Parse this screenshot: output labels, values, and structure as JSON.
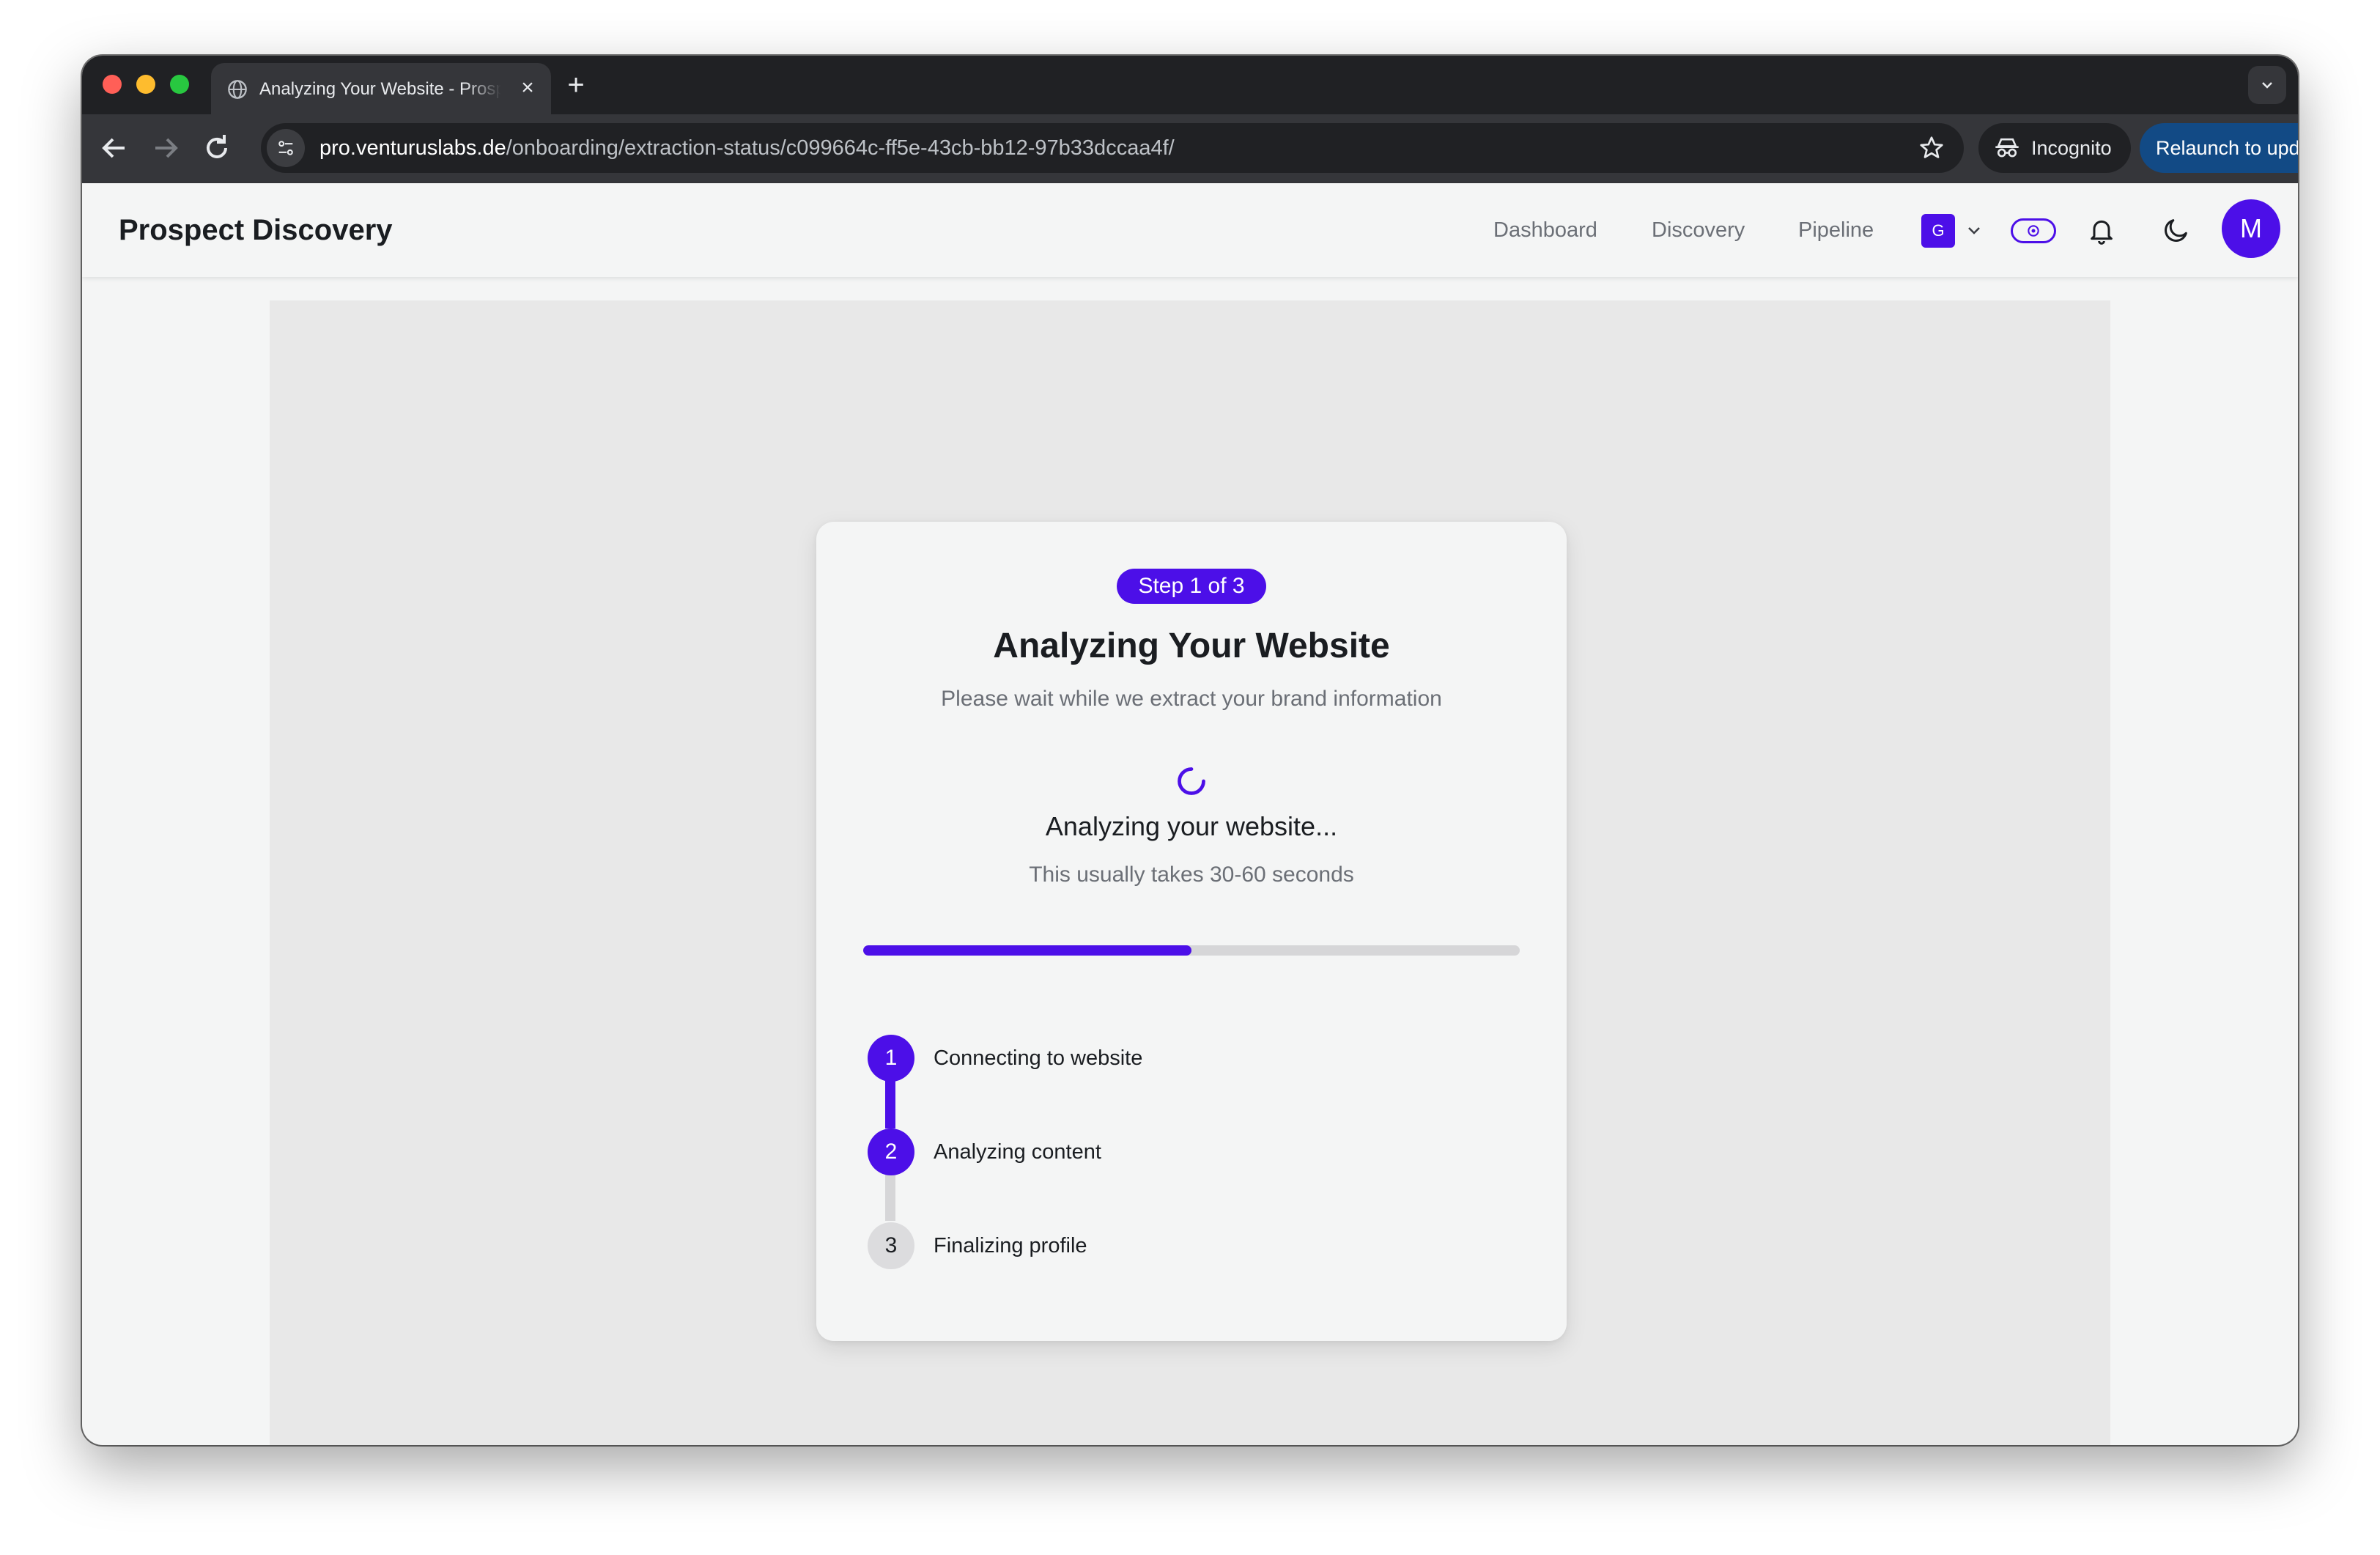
{
  "browser": {
    "tab_title": "Analyzing Your Website - Prospect Discovery",
    "url_host": "pro.venturuslabs.de",
    "url_path": "/onboarding/extraction-status/c099664c-ff5e-43cb-bb12-97b33dccaa4f/",
    "incognito_label": "Incognito",
    "relaunch_label": "Relaunch to update",
    "icons": [
      "globe-icon",
      "close-icon",
      "plus-icon",
      "chevron-down-icon",
      "back-arrow-icon",
      "forward-arrow-icon",
      "reload-icon",
      "site-settings-icon",
      "star-icon",
      "incognito-icon",
      "more-vert-icon"
    ]
  },
  "header": {
    "brand": "Prospect Discovery",
    "nav": [
      {
        "label": "Dashboard"
      },
      {
        "label": "Discovery"
      },
      {
        "label": "Pipeline"
      }
    ],
    "workspace_initial": "G",
    "avatar_initial": "M",
    "icons": [
      "chevron-down-icon",
      "eye-toggle-icon",
      "bell-icon",
      "moon-icon"
    ]
  },
  "card": {
    "step_pill": "Step 1 of 3",
    "title": "Analyzing Your Website",
    "subtitle": "Please wait while we extract your brand information",
    "status_title": "Analyzing your website...",
    "status_subtitle": "This usually takes 30-60 seconds",
    "progress_fraction": 0.5,
    "steps": [
      {
        "number": "1",
        "label": "Connecting to website",
        "state": "complete"
      },
      {
        "number": "2",
        "label": "Analyzing content",
        "state": "active"
      },
      {
        "number": "3",
        "label": "Finalizing profile",
        "state": "pending"
      }
    ]
  },
  "colors": {
    "accent": "#4c0fe8",
    "relaunch": "#124a85",
    "pending": "#dcdcde"
  }
}
